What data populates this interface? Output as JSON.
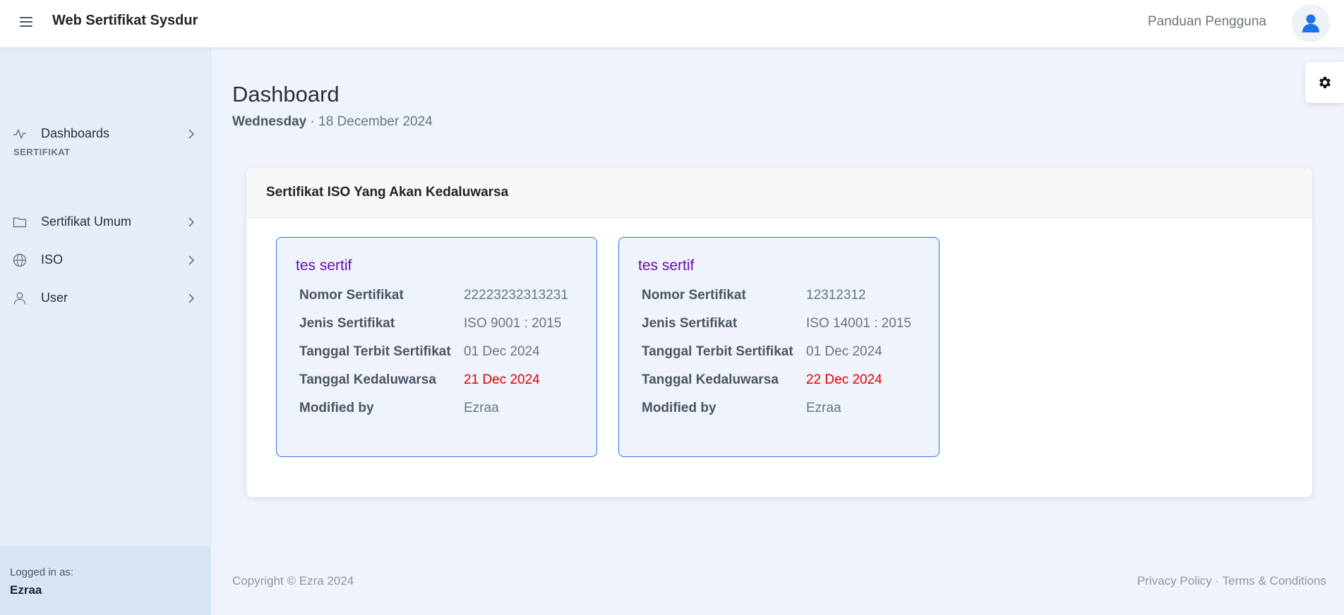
{
  "app": {
    "brand": "Web Sertifikat Sysdur",
    "guide_link": "Panduan Pengguna"
  },
  "sidebar": {
    "items": [
      {
        "label": "Dashboards",
        "icon": "activity-icon"
      },
      {
        "label": "Sertifikat Umum",
        "icon": "folder-icon"
      },
      {
        "label": "ISO",
        "icon": "globe-icon"
      },
      {
        "label": "User",
        "icon": "user-icon"
      }
    ],
    "section_heading": "SERTIFIKAT",
    "logged_in_label": "Logged in as:",
    "logged_in_user": "Ezraa"
  },
  "page": {
    "title": "Dashboard",
    "day": "Wednesday",
    "date": "· 18 December 2024"
  },
  "card": {
    "header": "Sertifikat ISO Yang Akan Kedaluwarsa",
    "certificates": [
      {
        "title": "tes sertif",
        "rows": [
          {
            "label": "Nomor Sertifikat",
            "value": "22223232313231"
          },
          {
            "label": "Jenis Sertifikat",
            "value": "ISO 9001 : 2015"
          },
          {
            "label": "Tanggal Terbit Sertifikat",
            "value": "01 Dec 2024"
          },
          {
            "label": "Tanggal Kedaluwarsa",
            "value": "21 Dec 2024"
          },
          {
            "label": "Modified by",
            "value": "Ezraa"
          }
        ]
      },
      {
        "title": "tes sertif",
        "rows": [
          {
            "label": "Nomor Sertifikat",
            "value": "12312312"
          },
          {
            "label": "Jenis Sertifikat",
            "value": "ISO 14001 : 2015"
          },
          {
            "label": "Tanggal Terbit Sertifikat",
            "value": "01 Dec 2024"
          },
          {
            "label": "Tanggal Kedaluwarsa",
            "value": "22 Dec 2024"
          },
          {
            "label": "Modified by",
            "value": "Ezraa"
          }
        ]
      }
    ]
  },
  "footer": {
    "copyright": "Copyright © Ezra 2024",
    "privacy": "Privacy Policy",
    "separator": "·",
    "terms": "Terms & Conditions"
  },
  "colors": {
    "accent_border": "#2f74e0",
    "cert_title": "#6a0dad",
    "expiry": "#e30000",
    "sidebar_bg": "#e5edfb"
  }
}
